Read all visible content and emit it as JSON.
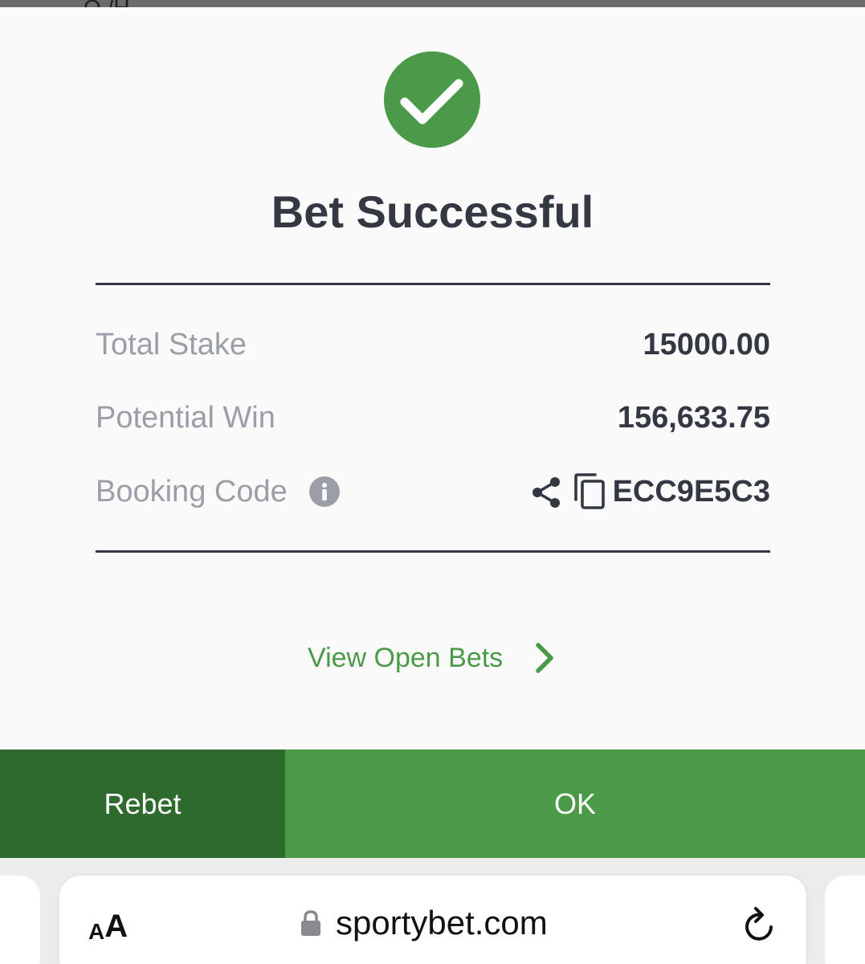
{
  "background_header": {
    "partial_text": "O /H"
  },
  "modal": {
    "title": "Bet Successful",
    "rows": [
      {
        "label": "Total Stake",
        "value": "15000.00"
      },
      {
        "label": "Potential Win",
        "value": "156,633.75"
      },
      {
        "label": "Booking Code",
        "value": "ECC9E5C3"
      }
    ],
    "view_open_bets": "View Open Bets",
    "rebet_label": "Rebet",
    "ok_label": "OK"
  },
  "browser": {
    "text_size_small": "A",
    "text_size_large": "A",
    "url": "sportybet.com"
  },
  "icons": {
    "success": "checkmark-circle-icon",
    "info": "info-icon",
    "share": "share-icon",
    "copy": "copy-icon",
    "chevron": "chevron-right-icon",
    "lock": "lock-icon",
    "reload": "reload-icon"
  },
  "colors": {
    "accent_green": "#4a9a47",
    "dark_green": "#2e6a2e",
    "text_dark": "#333842",
    "text_muted": "#9b9ea6"
  }
}
